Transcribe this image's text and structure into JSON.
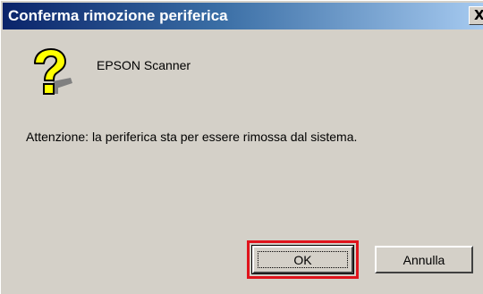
{
  "dialog": {
    "title": "Conferma rimozione periferica",
    "close_label": "X",
    "icon": "question-mark-icon",
    "device_name": "EPSON Scanner",
    "message": "Attenzione: la periferica sta per essere rimossa dal sistema.",
    "ok_label": "OK",
    "cancel_label": "Annulla",
    "highlight_color": "#e0141c",
    "title_bar_color": "#0a246a",
    "dialog_color": "#d4d0c8"
  }
}
